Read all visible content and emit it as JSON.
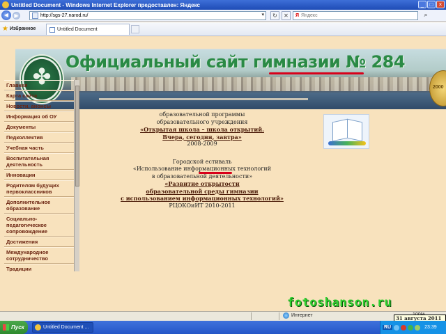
{
  "window": {
    "title": "Untitled Document - Windows Internet Explorer предоставлен: Яндекс"
  },
  "address": {
    "url": "http://sgs-27.narod.ru/"
  },
  "search": {
    "brand": "Я",
    "placeholder": "Яндекс"
  },
  "favorites": {
    "label": "Избранное"
  },
  "tab": {
    "label": "Untitled Document"
  },
  "banner": {
    "title": "Официальный сайт гимназии № 284",
    "medal_text": "2000"
  },
  "sidebar": {
    "items": [
      "Главная",
      "Карта сайта",
      "Новости, анонсы",
      "Информация об ОУ",
      "Документы",
      "Педколлектив",
      "Учебная часть",
      "Воспитательная деятельность",
      "Инновации",
      "Родителям будущих первоклассников",
      "Дополнительное образование",
      "Социально-педагогическое сопровождение",
      "Достижения",
      "Международное сотрудничество",
      "Традиции"
    ]
  },
  "main": {
    "line1": "образовательной программы",
    "line2": "образовательного учреждения",
    "open_link_1": "«Открытая школа – школа открытий.",
    "open_link_2": "Вчера, сегодня, завтра»",
    "years1": "2008-2009",
    "festival_line": "Городской фестиваль",
    "festival_visible": "Городской",
    "festival_word": "естиваль",
    "topic1": "«Использование информационных технологий",
    "topic2": "в образовательной деятельности»",
    "dev_link_1": "«Развитие открытости",
    "dev_link_2": "образовательной среды гимназии",
    "dev_link_3": "с использованием информационных технологий»",
    "org": "РЦОКОиИТ 2010-2011"
  },
  "watermark": "fotoshanson.ru",
  "status": {
    "zone": "Интернет",
    "zoom": "100%"
  },
  "taskbar": {
    "start": "Пуск",
    "item": "Untitled Document ...",
    "lang": "RU",
    "clock": "23:39",
    "date_tip": "31 августа 2011 г."
  },
  "colors": {
    "page_bg": "#f8e2bd",
    "nav_text": "#6a2310",
    "title_green": "#2a8a45",
    "accent_red": "#d8001a",
    "watermark_green": "#2ed02e"
  }
}
